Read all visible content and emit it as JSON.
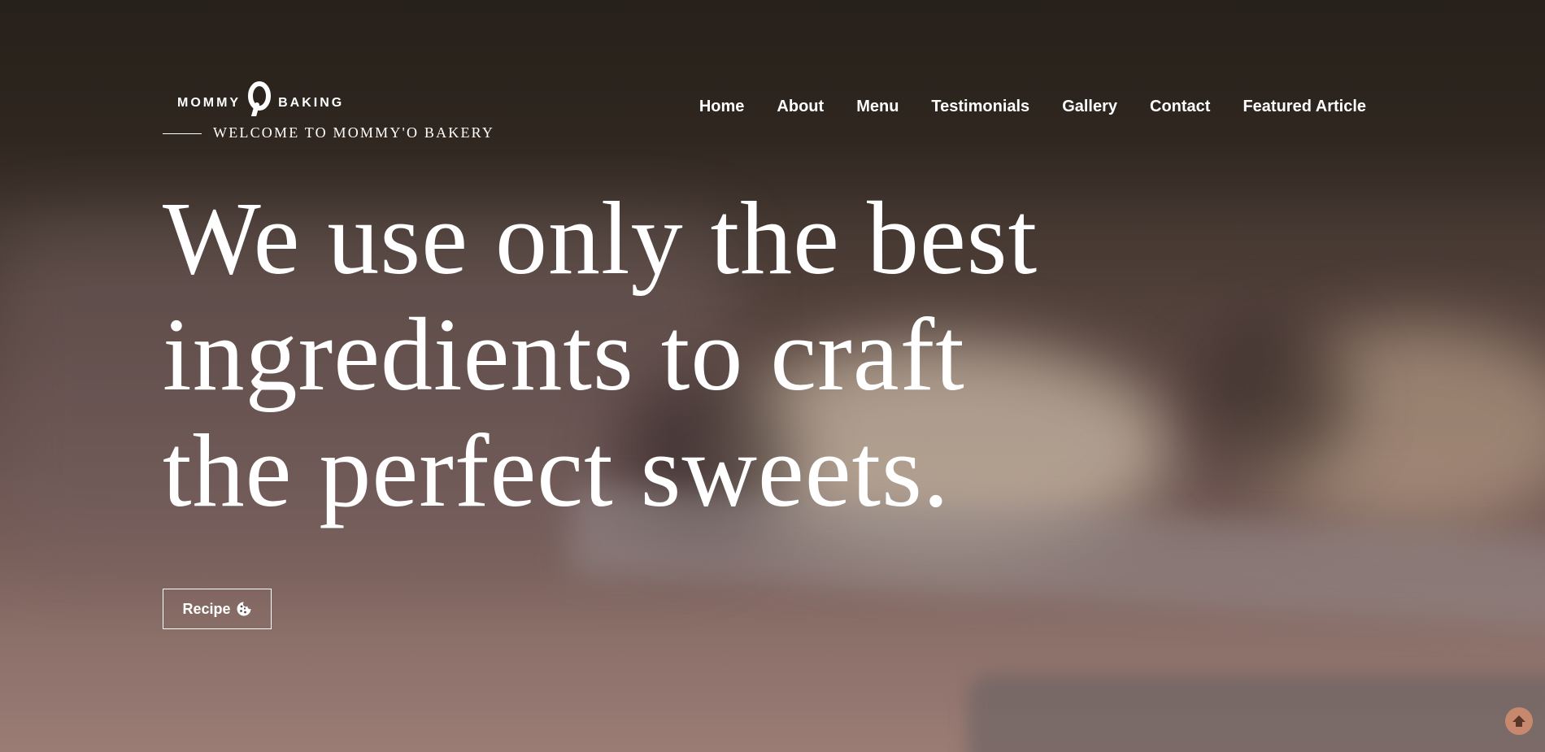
{
  "brand": {
    "name_left": "MOMMY",
    "name_right": "BAKING",
    "tagline": "WELCOME TO MOMMY'O BAKERY"
  },
  "nav": {
    "items": [
      {
        "label": "Home"
      },
      {
        "label": "About"
      },
      {
        "label": "Menu"
      },
      {
        "label": "Testimonials"
      },
      {
        "label": "Gallery"
      },
      {
        "label": "Contact"
      },
      {
        "label": "Featured Article"
      }
    ]
  },
  "hero": {
    "headline_lines": [
      "We use only the best",
      "ingredients to craft",
      "the perfect sweets."
    ],
    "cta_label": "Recipe",
    "cta_icon": "cookie-icon"
  },
  "scroll_top": {
    "icon": "arrow-up-icon",
    "color": "#c8886e"
  },
  "colors": {
    "text": "#ffffff",
    "background": "#3a2f27"
  }
}
